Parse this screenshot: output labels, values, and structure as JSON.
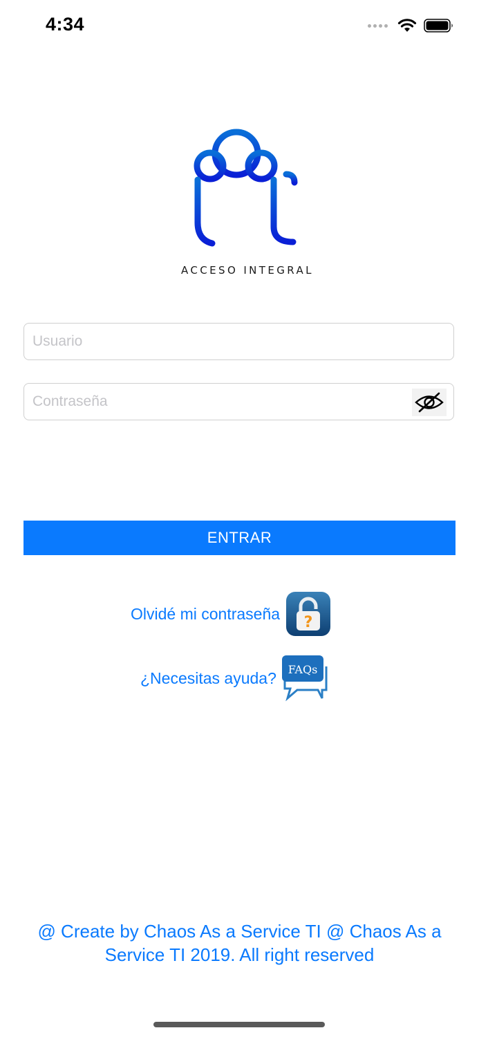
{
  "status_bar": {
    "time": "4:34"
  },
  "logo": {
    "text": "ACCESO INTEGRAL",
    "color": "#0a4fd6"
  },
  "form": {
    "username": {
      "placeholder": "Usuario",
      "value": ""
    },
    "password": {
      "placeholder": "Contraseña",
      "value": ""
    },
    "toggle_icon": "eye-slash-icon"
  },
  "login_button": {
    "label": "ENTRAR",
    "color": "#0a7afe"
  },
  "links": {
    "forgot_password": {
      "label": "Olvidé mi contraseña",
      "icon": "lock-question-icon"
    },
    "help": {
      "label": "¿Necesitas ayuda?",
      "icon": "faqs-chat-icon",
      "icon_text": "FAQs"
    }
  },
  "footer": {
    "text": "@ Create by Chaos As a Service TI @ Chaos As a Service TI 2019. All right reserved"
  }
}
